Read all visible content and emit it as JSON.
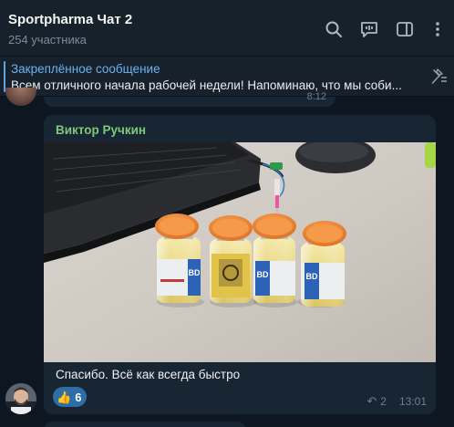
{
  "header": {
    "title": "Sportpharma Чат 2",
    "subtitle": "254 участника",
    "icons": [
      "search-icon",
      "chat-topics-icon",
      "sidebar-panel-icon",
      "more-vertical-icon"
    ]
  },
  "pinned": {
    "title": "Закреплённое сообщение",
    "text": "Всем отличного начала рабочей недели! Напоминаю, что мы соби..."
  },
  "prev_message": {
    "time": "8:12"
  },
  "message": {
    "sender": "Виктор Ручкин",
    "caption": "Спасибо. Всё как всегда быстро",
    "reaction": {
      "emoji": "👍",
      "count": "6"
    },
    "replies": "2",
    "time": "13:01"
  },
  "photo": {
    "vial_labels": [
      "BD",
      "",
      "BD",
      "BD"
    ]
  },
  "colors": {
    "background": "#0e1621",
    "header": "#17212b",
    "bubble": "#182533",
    "accent": "#6ab3f3",
    "sender": "#7fc97a",
    "reaction": "#2f6ea5"
  }
}
